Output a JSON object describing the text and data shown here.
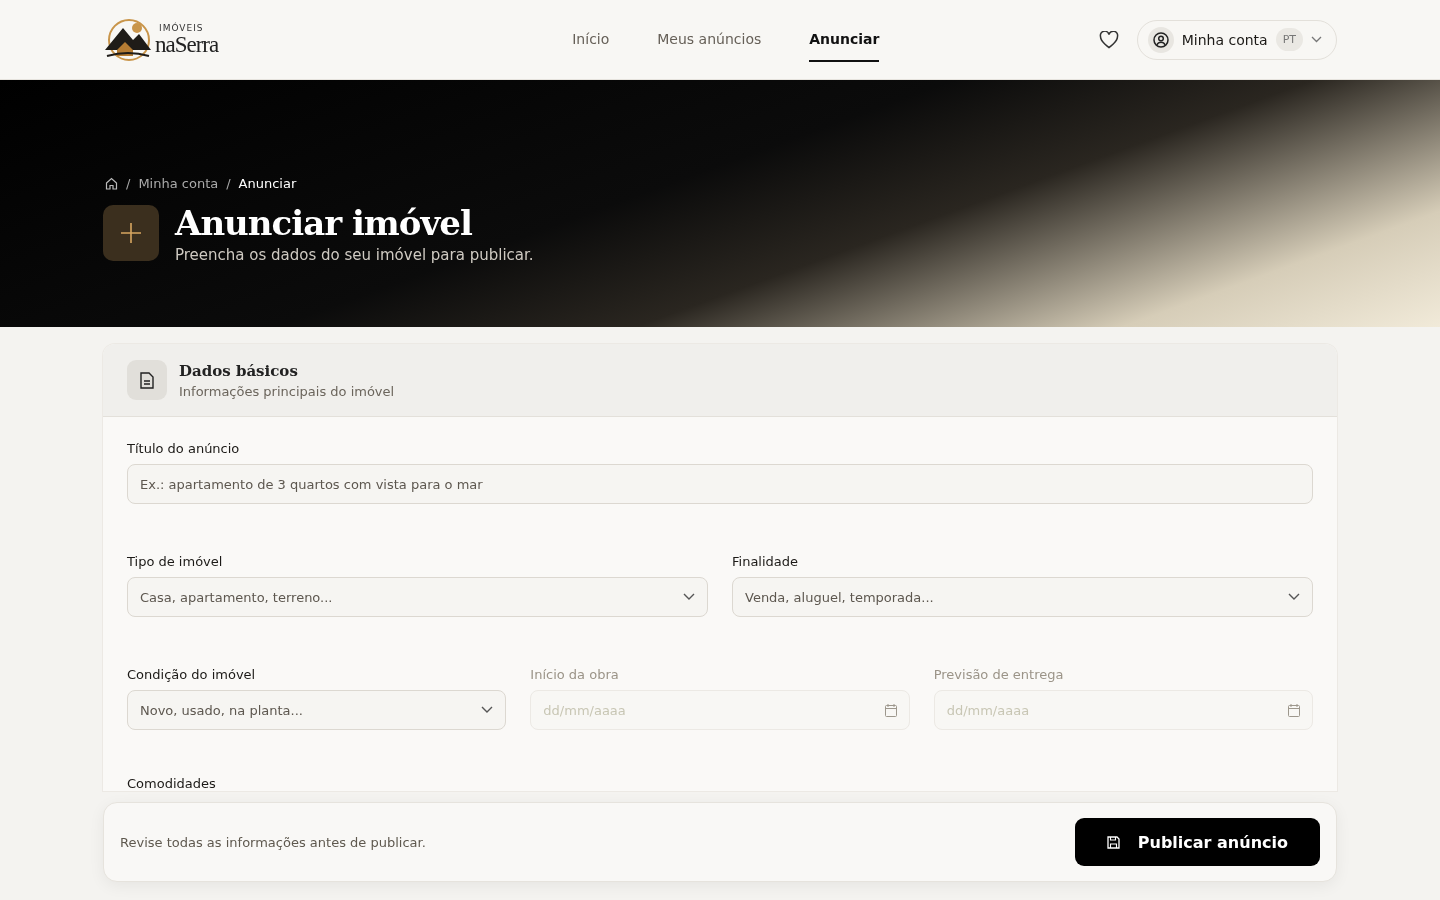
{
  "logo": {
    "small": "IMÓVEIS",
    "big": "naSerra"
  },
  "nav": [
    {
      "label": "Início",
      "selected": false
    },
    {
      "label": "Meus anúncios",
      "selected": false
    },
    {
      "label": "Anunciar",
      "selected": true
    }
  ],
  "account": {
    "label": "Minha conta",
    "language": "PT"
  },
  "breadcrumb": {
    "separator": "/",
    "items": [
      "Minha conta",
      "Anunciar"
    ]
  },
  "hero": {
    "title": "Anunciar imóvel",
    "subtitle": "Preencha os dados do seu imóvel para publicar."
  },
  "section": {
    "title": "Dados básicos",
    "subtitle": "Informações principais do imóvel"
  },
  "rows": [
    [
      {
        "label": "Título do anúncio",
        "placeholder": "Ex.: apartamento de 3 quartos com vista para o mar",
        "kind": "text",
        "disabled": false
      }
    ],
    [
      {
        "label": "Tipo de imóvel",
        "placeholder": "Casa, apartamento, terreno...",
        "kind": "select",
        "disabled": false
      },
      {
        "label": "Finalidade",
        "placeholder": "Venda, aluguel, temporada...",
        "kind": "select",
        "disabled": false
      }
    ],
    [
      {
        "label": "Condição do imóvel",
        "placeholder": "Novo, usado, na planta...",
        "kind": "select",
        "disabled": false
      },
      {
        "label": "Início da obra",
        "placeholder": "dd/mm/aaaa",
        "kind": "date",
        "disabled": true
      },
      {
        "label": "Previsão de entrega",
        "placeholder": "dd/mm/aaaa",
        "kind": "date",
        "disabled": true
      }
    ]
  ],
  "next_label": "Comodidades",
  "footer": {
    "note": "Revise todas as informações antes de publicar.",
    "button": "Publicar anúncio"
  }
}
